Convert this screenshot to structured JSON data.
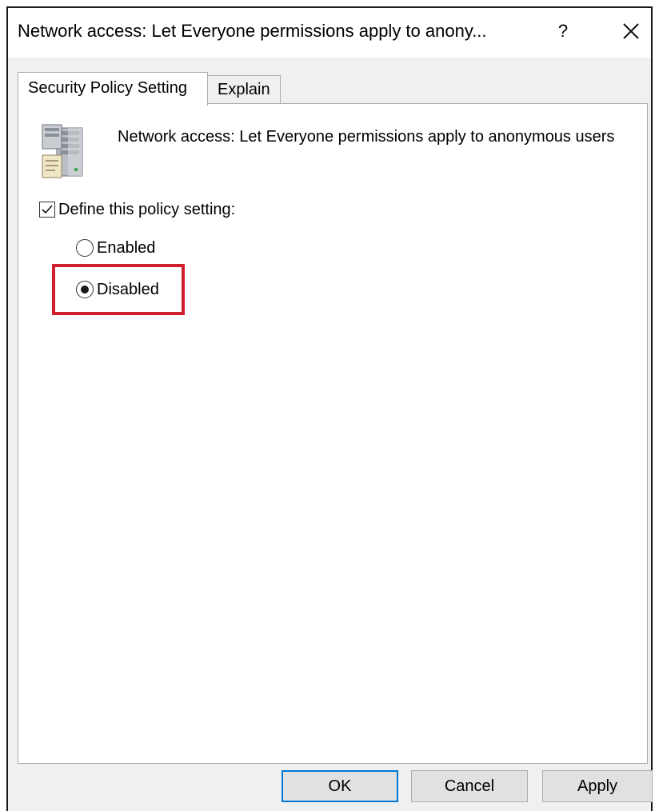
{
  "window": {
    "title": "Network access: Let Everyone permissions apply to anony...",
    "help_label": "?"
  },
  "tabs": [
    {
      "label": "Security Policy Setting",
      "active": true
    },
    {
      "label": "Explain",
      "active": false
    }
  ],
  "policy": {
    "description": "Network access: Let Everyone permissions apply to anonymous users",
    "define_label": "Define this policy setting:",
    "define_checked": true,
    "options": [
      {
        "label": "Enabled",
        "selected": false
      },
      {
        "label": "Disabled",
        "selected": true
      }
    ]
  },
  "buttons": {
    "ok": "OK",
    "cancel": "Cancel",
    "apply": "Apply"
  },
  "colors": {
    "highlight": "#d0202e",
    "default_button_border": "#0078d7"
  },
  "icons": {
    "policy": "server-policy-icon",
    "close": "close-icon"
  }
}
